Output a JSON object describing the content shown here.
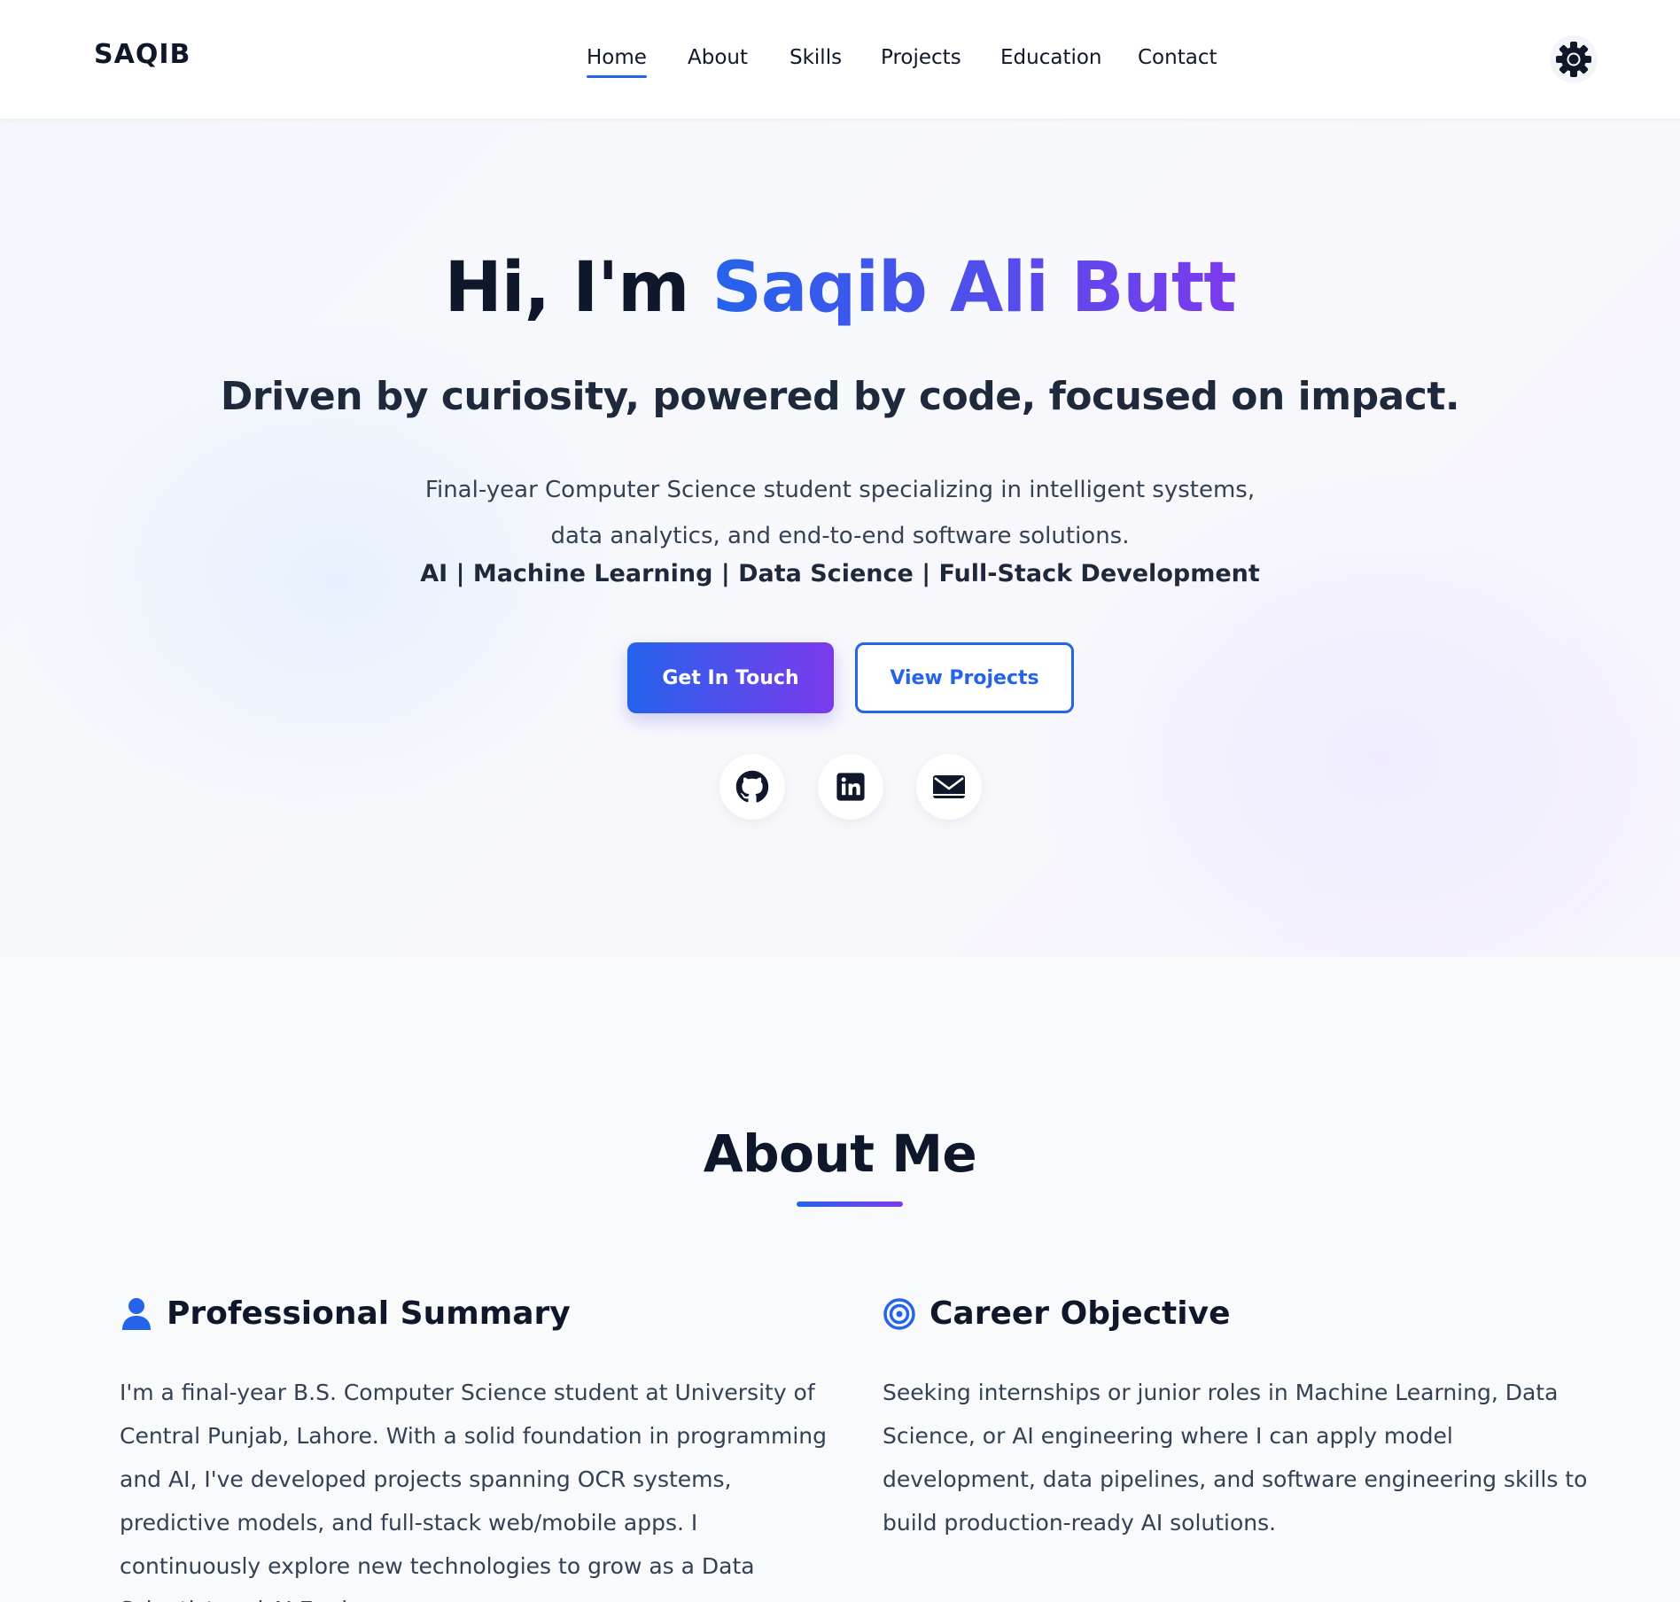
{
  "brand": {
    "logo": "SAQIB"
  },
  "nav": {
    "items": [
      {
        "label": "Home",
        "active": true
      },
      {
        "label": "About",
        "active": false
      },
      {
        "label": "Skills",
        "active": false
      },
      {
        "label": "Projects",
        "active": false
      },
      {
        "label": "Education",
        "active": false
      },
      {
        "label": "Contact",
        "active": false
      }
    ],
    "theme_toggle_icon": "gear-icon"
  },
  "hero": {
    "greeting": "Hi, I'm ",
    "name": "Saqib Ali Butt",
    "tagline": "Driven by curiosity, powered by code, focused on impact.",
    "description": "Final-year Computer Science student specializing in intelligent systems, data analytics, and end-to-end software solutions.",
    "focus": "AI | Machine Learning | Data Science | Full-Stack Development",
    "primary_button": "Get In Touch",
    "secondary_button": "View Projects",
    "socials": [
      "github-icon",
      "linkedin-icon",
      "envelope-icon"
    ]
  },
  "about": {
    "title": "About Me",
    "summary": {
      "icon": "user-icon",
      "heading": "Professional Summary",
      "text": "I'm a final-year B.S. Computer Science student at University of Central Punjab, Lahore. With a solid foundation in programming and AI, I've developed projects spanning OCR systems, predictive models, and full-stack web/mobile apps. I continuously explore new technologies to grow as a Data Scientist and AI Engineer."
    },
    "objective": {
      "icon": "target-icon",
      "heading": "Career Objective",
      "text": "Seeking internships or junior roles in Machine Learning, Data Science, or AI engineering where I can apply model development, data pipelines, and software engineering skills to build production-ready AI solutions."
    }
  },
  "colors": {
    "accent_blue": "#2563eb",
    "accent_purple": "#7c3aed",
    "text_dark": "#0f172a",
    "text_body": "#334155"
  }
}
